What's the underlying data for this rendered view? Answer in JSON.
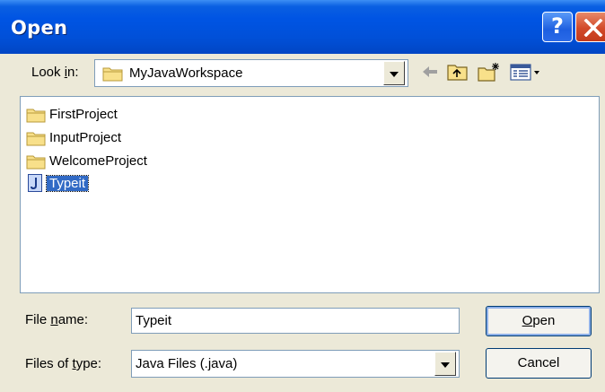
{
  "window": {
    "title": "Open",
    "help_glyph": "?"
  },
  "look_in": {
    "label_pre": "Look ",
    "label_accel": "i",
    "label_post": "n:",
    "value": "MyJavaWorkspace",
    "icon": "folder-icon"
  },
  "toolbar": {
    "back_icon": "back-arrow-icon",
    "up_icon": "up-folder-icon",
    "new_folder_icon": "new-folder-icon",
    "view_menu_icon": "view-menu-icon"
  },
  "files": [
    {
      "name": "FirstProject",
      "icon": "folder-icon",
      "selected": false
    },
    {
      "name": "InputProject",
      "icon": "folder-icon",
      "selected": false
    },
    {
      "name": "WelcomeProject",
      "icon": "folder-icon",
      "selected": false
    },
    {
      "name": "Typeit",
      "icon": "java-file-icon",
      "selected": true
    }
  ],
  "file_name": {
    "label_pre": "File ",
    "label_accel": "n",
    "label_post": "ame:",
    "value": "Typeit"
  },
  "files_of_type": {
    "label_pre": "Files of ",
    "label_accel": "t",
    "label_post": "ype:",
    "value": "Java Files (.java)"
  },
  "buttons": {
    "open_accel": "O",
    "open_rest": "pen",
    "cancel": "Cancel"
  },
  "colors": {
    "title_bar": "#0054e3",
    "selection": "#316ac5",
    "dialog_bg": "#ece9d8"
  }
}
